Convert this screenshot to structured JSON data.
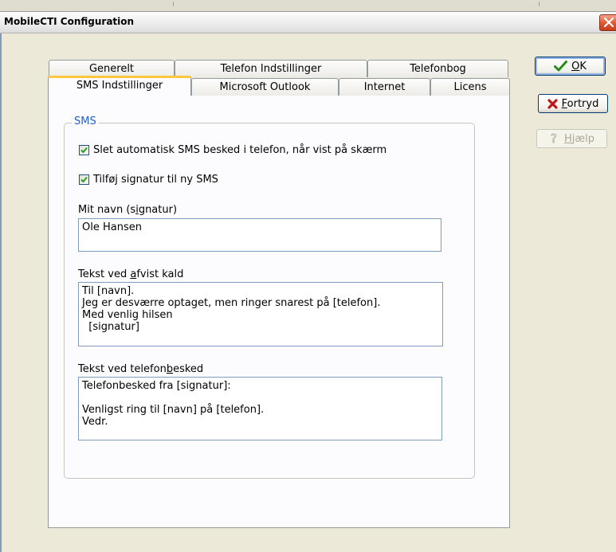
{
  "window": {
    "title": "MobileCTI Configuration"
  },
  "tabs": {
    "row_back": [
      {
        "label": "Generelt"
      },
      {
        "label": "Telefon Indstillinger"
      },
      {
        "label": "Telefonbog"
      }
    ],
    "row_front": [
      {
        "label": "SMS Indstillinger",
        "active": true
      },
      {
        "label": "Microsoft Outlook"
      },
      {
        "label": "Internet"
      },
      {
        "label": "Licens"
      }
    ]
  },
  "sms": {
    "group_title": "SMS",
    "auto_delete": {
      "label": "Slet automatisk SMS besked i telefon, når vist på skærm",
      "checked": true
    },
    "add_signature": {
      "label": "Tilføj signatur til ny SMS",
      "checked": true
    },
    "name_label": {
      "pre": "Mit navn (s",
      "accel": "i",
      "post": "gnatur)"
    },
    "name_value": "Ole Hansen",
    "rejected_label": {
      "pre": "Tekst ved ",
      "accel": "a",
      "post": "fvist kald"
    },
    "rejected_value": "Til [navn].\nJeg er desværre optaget, men ringer snarest på [telefon].\nMed venlig hilsen\n  [signatur]",
    "message_label": {
      "pre": "Tekst ved telefon",
      "accel": "b",
      "post": "esked"
    },
    "message_value": "Telefonbesked fra [signatur]:\n\nVenligst ring til [navn] på [telefon].\nVedr."
  },
  "buttons": {
    "ok": {
      "accel": "O",
      "rest": "K",
      "icon": "check-icon",
      "color": "#2a8a1a"
    },
    "cancel": {
      "accel": "F",
      "rest": "ortryd",
      "icon": "red-x-icon",
      "color": "#c01818"
    },
    "help": {
      "accel": "H",
      "rest": "jælp",
      "icon": "help-question-icon",
      "enabled": false
    }
  }
}
